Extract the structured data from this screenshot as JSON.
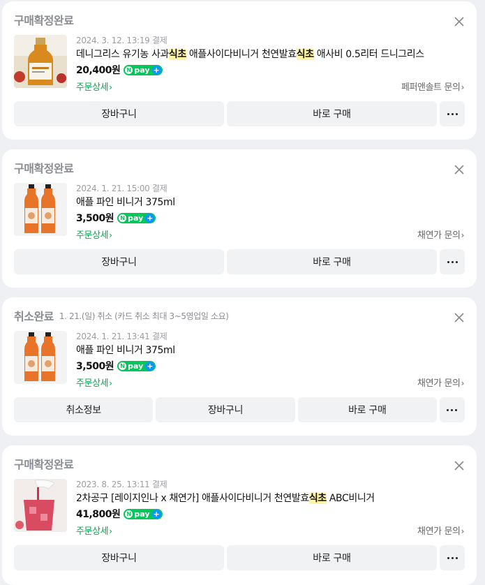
{
  "orders": [
    {
      "status": "구매확정완료",
      "status_note": "",
      "date": "2024. 3. 12. 13:19 결제",
      "title_parts": [
        "데니그리스 유기농 사과",
        "식초",
        " 애플사이다비니거 천연발효",
        "식초",
        " 애사비 0.5리터 드니그리스"
      ],
      "price": "20,400원",
      "detail_label": "주문상세",
      "seller_label": "페퍼앤솔트 문의",
      "buttons": [
        "장바구니",
        "바로 구매"
      ],
      "thumb_icon": "apple-cider-vinegar-bottle-image"
    },
    {
      "status": "구매확정완료",
      "status_note": "",
      "date": "2024. 1. 21. 15:00 결제",
      "title_parts": [
        "애플 파인 비니거 375ml"
      ],
      "price": "3,500원",
      "detail_label": "주문상세",
      "seller_label": "채연가 문의",
      "buttons": [
        "장바구니",
        "바로 구매"
      ],
      "thumb_icon": "vinegar-bottles-image"
    },
    {
      "status": "취소완료",
      "status_note": "1. 21.(일) 취소 (카드 취소 최대 3~5영업일 소요)",
      "date": "2024. 1. 21. 13:41 결제",
      "title_parts": [
        "애플 파인 비니거 375ml"
      ],
      "price": "3,500원",
      "detail_label": "주문상세",
      "seller_label": "채연가 문의",
      "buttons": [
        "취소정보",
        "장바구니",
        "바로 구매"
      ],
      "thumb_icon": "vinegar-bottles-image"
    },
    {
      "status": "구매확정완료",
      "status_note": "",
      "date": "2023. 8. 25. 13:11 결제",
      "title_parts": [
        "2차공구 [레이지인나 x 채연가] 애플사이다비니거 천연발효",
        "식초",
        " ABC비니거"
      ],
      "price": "41,800원",
      "detail_label": "주문상세",
      "seller_label": "채연가 문의",
      "buttons": [
        "장바구니",
        "바로 구매"
      ],
      "thumb_icon": "red-drink-glass-image"
    }
  ],
  "npay": {
    "n": "N",
    "pay": "pay",
    "plus": "+"
  },
  "chevron": "›",
  "colors": {
    "accent_green": "#03c75a",
    "highlight": "#fff3a6",
    "status_gray": "#8a8d93"
  }
}
